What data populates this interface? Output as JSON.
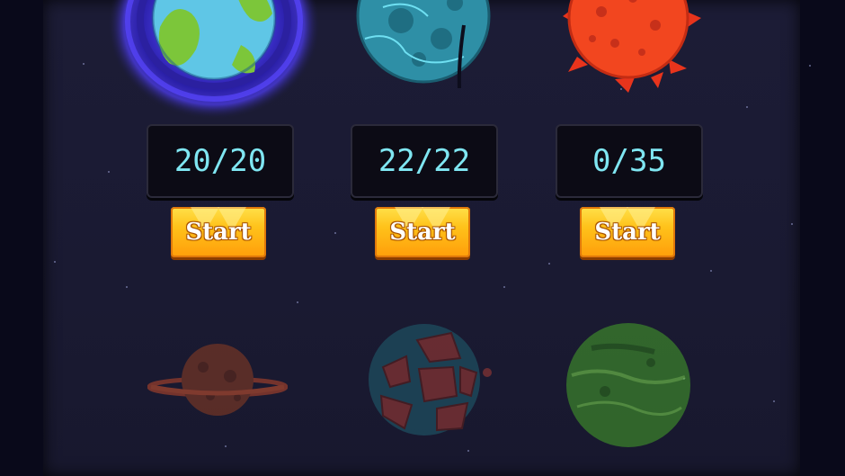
{
  "levels": [
    {
      "planet": "earth-planet",
      "progress": "20/20",
      "start_label": "Start"
    },
    {
      "planet": "teal-crater-planet",
      "progress": "22/22",
      "start_label": "Start"
    },
    {
      "planet": "red-spiky-planet",
      "progress": "0/35",
      "start_label": "Start"
    }
  ],
  "locked_planets": [
    "ringed-brown-planet",
    "rocky-red-planet",
    "green-planet"
  ],
  "colors": {
    "counter_text": "#7fe6f2",
    "button_gold": "#ffc21a",
    "background": "#1a1a32"
  }
}
